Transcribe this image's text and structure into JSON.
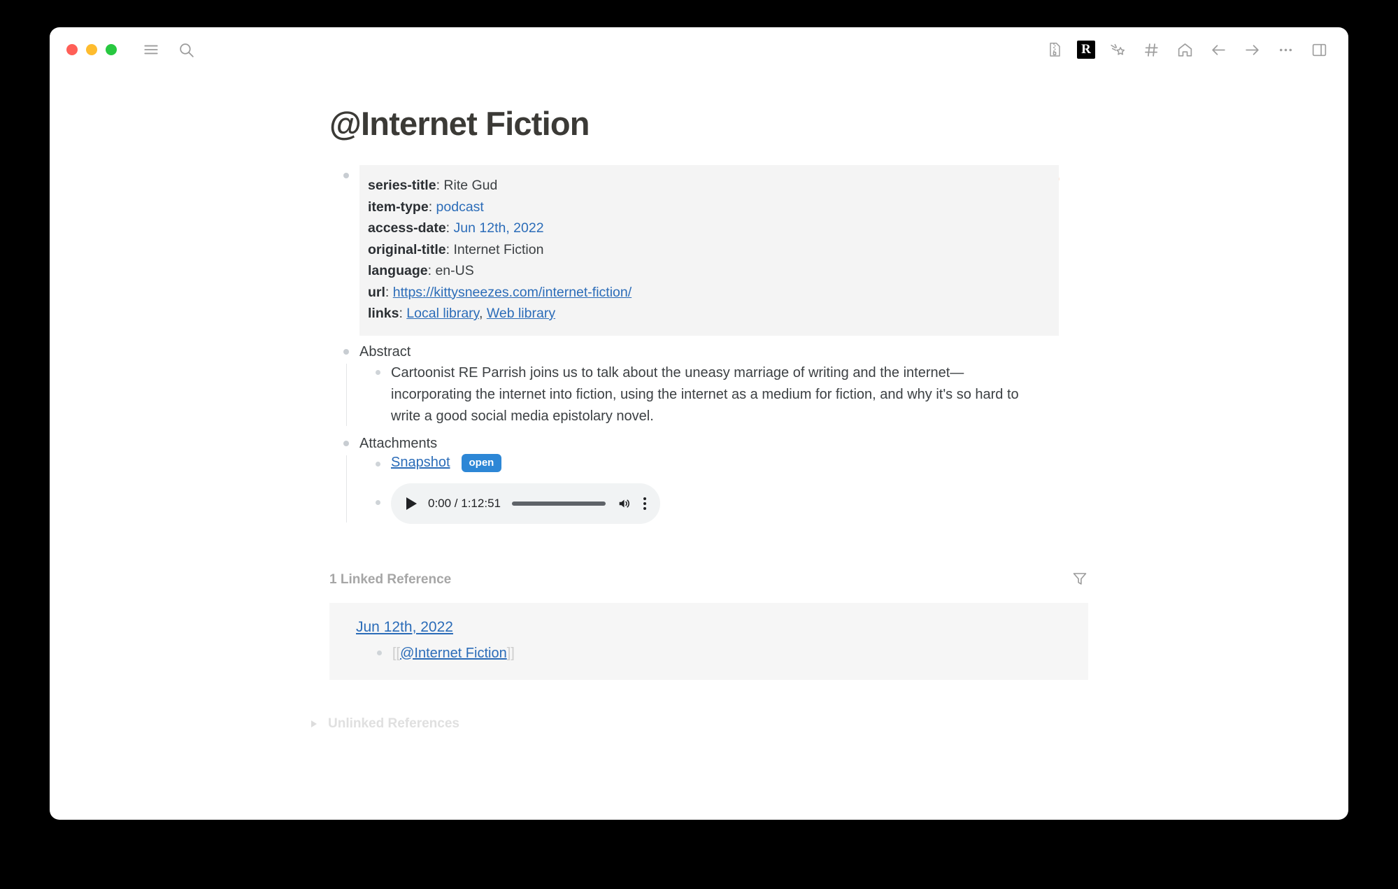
{
  "window": {
    "traffic_lights": [
      {
        "name": "close",
        "color": "#FF5F57"
      },
      {
        "name": "minimize",
        "color": "#FEBC2E"
      },
      {
        "name": "maximize",
        "color": "#28C840"
      }
    ],
    "toolbar_left": [
      "menu-icon",
      "search-icon"
    ],
    "toolbar_right": [
      "zip-file-icon",
      "roam-logo-icon",
      "shooting-star-icon",
      "hashtag-icon",
      "home-icon",
      "back-arrow-icon",
      "forward-arrow-icon",
      "more-options-icon",
      "right-sidebar-icon"
    ],
    "roam_logo_letter": "R"
  },
  "page": {
    "title": "@Internet Fiction"
  },
  "metadata": {
    "rows": [
      {
        "key": "series-title",
        "value": "Rite Gud",
        "link": false
      },
      {
        "key": "item-type",
        "value": "podcast",
        "link": true
      },
      {
        "key": "access-date",
        "value": "Jun 12th, 2022",
        "link": true
      },
      {
        "key": "original-title",
        "value": "Internet Fiction",
        "link": false
      },
      {
        "key": "language",
        "value": "en-US",
        "link": false
      }
    ],
    "url_key": "url",
    "url_value": "https://kittysneezes.com/internet-fiction/",
    "links_key": "links",
    "links": [
      "Local library",
      "Web library"
    ],
    "links_separator": ", "
  },
  "abstract": {
    "heading": "Abstract",
    "text": "Cartoonist RE Parrish joins us to talk about the uneasy marriage of writing and the internet—incorporating the internet into fiction, using the internet as a medium for fiction, and why it's so hard to write a good social media epistolary novel."
  },
  "attachments": {
    "heading": "Attachments",
    "snapshot_label": "Snapshot",
    "open_badge": "open",
    "open_badge_color": "#2D87D6",
    "audio": {
      "current_time": "0:00",
      "duration": "1:12:51",
      "time_display": "0:00 / 1:12:51",
      "progress_percent": 0
    }
  },
  "references": {
    "linked_count_label": "1 Linked Reference",
    "filter_icon": "filter-icon",
    "items": [
      {
        "date": "Jun 12th, 2022",
        "bracket_open": "[[",
        "ref_text": "@Internet Fiction",
        "bracket_close": "]]"
      }
    ],
    "unlinked_label": "Unlinked References"
  }
}
